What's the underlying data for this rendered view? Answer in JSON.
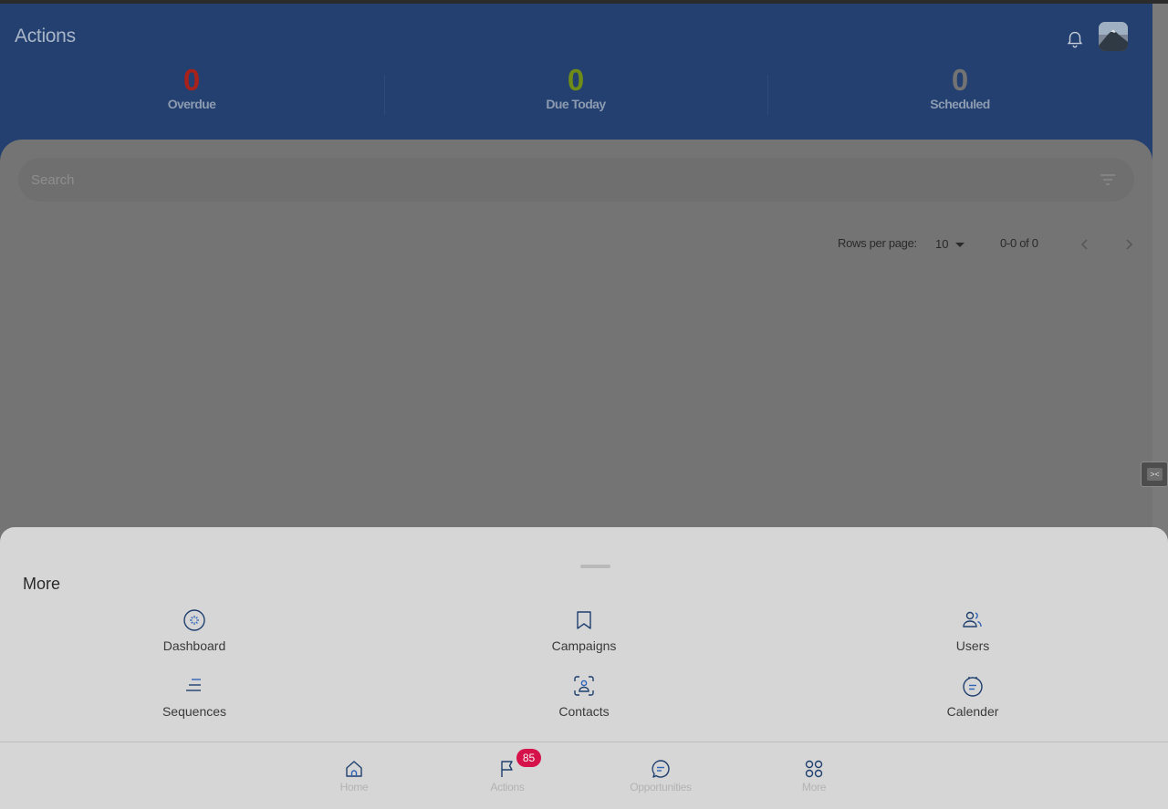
{
  "header": {
    "title": "Actions",
    "stats": [
      {
        "value": "0",
        "label": "Overdue",
        "color": "#a8211b"
      },
      {
        "value": "0",
        "label": "Due Today",
        "color": "#6f8b18"
      },
      {
        "value": "0",
        "label": "Scheduled",
        "color": "#737373"
      }
    ],
    "icons": {
      "notifications": "bell-icon",
      "profile": "avatar"
    }
  },
  "search": {
    "placeholder": "Search",
    "value": "",
    "filter_icon": "filter-icon"
  },
  "pagination": {
    "rows_per_page_label": "Rows per page:",
    "rows_per_page_value": "10",
    "range_text": "0-0 of 0",
    "prev_icon": "chevron-left-icon",
    "next_icon": "chevron-right-icon"
  },
  "more_sheet": {
    "title": "More",
    "items": [
      {
        "label": "Dashboard",
        "icon": "dashboard-icon"
      },
      {
        "label": "Campaigns",
        "icon": "bookmark-icon"
      },
      {
        "label": "Users",
        "icon": "users-icon"
      },
      {
        "label": "Sequences",
        "icon": "sequences-icon"
      },
      {
        "label": "Contacts",
        "icon": "contacts-icon"
      },
      {
        "label": "Calender",
        "icon": "calendar-icon"
      }
    ]
  },
  "bottom_nav": {
    "items": [
      {
        "label": "Home",
        "icon": "home-icon"
      },
      {
        "label": "Actions",
        "icon": "flag-icon",
        "badge": "85"
      },
      {
        "label": "Opportunities",
        "icon": "chat-icon"
      },
      {
        "label": "More",
        "icon": "grid-icon"
      }
    ]
  },
  "colors": {
    "header_bg": "#234070",
    "accent": "#2f63b8",
    "badge": "#d6124a"
  }
}
